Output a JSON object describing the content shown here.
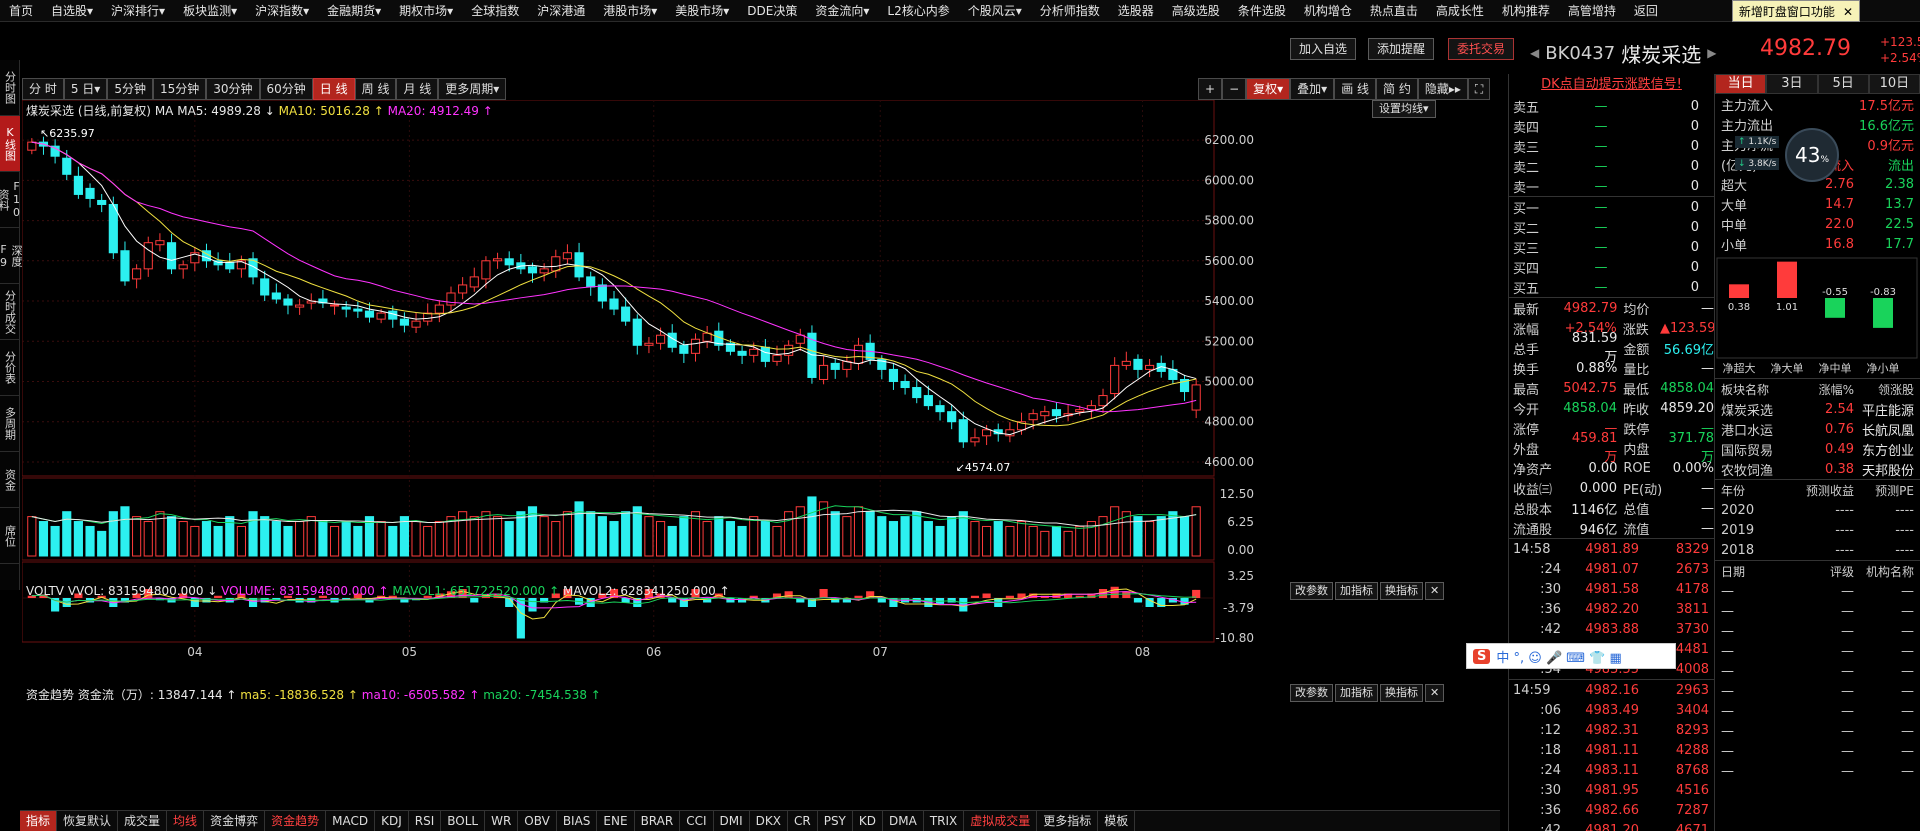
{
  "menu": [
    "首页",
    "自选股▾",
    "沪深排行▾",
    "板块监测▾",
    "沪深指数▾",
    "金融期货▾",
    "期权市场▾",
    "全球指数",
    "沪深港通",
    "港股市场▾",
    "美股市场▾",
    "DDE决策",
    "资金流向▾",
    "L2核心内参",
    "个股风云▾",
    "分析师指数",
    "选股器",
    "高级选股",
    "条件选股",
    "机构增仓",
    "热点直击",
    "高成长性",
    "机构推荐",
    "高管增持",
    "返回"
  ],
  "notice": {
    "text": "新增盯盘窗口功能",
    "close": "✕"
  },
  "left_nav": [
    "分时图",
    "K线图",
    "F10资料",
    "深度F9",
    "分时成交",
    "分价表",
    "多周期",
    "资金",
    "席位"
  ],
  "top_buttons": [
    "加入自选",
    "添加提醒",
    "委托交易"
  ],
  "stock": {
    "code": "BK0437",
    "name": "煤炭采选",
    "price": "4982.79",
    "change": "+123.59",
    "pct": "+2.54%"
  },
  "period_bar": [
    "分 时",
    "5 日▾",
    "5分钟",
    "15分钟",
    "30分钟",
    "60分钟",
    "日 线",
    "周 线",
    "月 线",
    "更多周期▾"
  ],
  "right_tools": [
    "+",
    "−",
    "复权▾",
    "叠加▾",
    "画 线",
    "简 约",
    "隐藏▸▸",
    "⛶"
  ],
  "dk_link": "DK点自动提示涨跌信号!",
  "ma_legend": {
    "title": "煤炭采选 (日线,前复权)",
    "ma": "MA",
    "ma5": "MA5: 4989.28 ↓",
    "ma10": "MA10: 5016.28 ↑",
    "ma20": "MA20: 4912.49 ↑",
    "set": "设置均线▾"
  },
  "vol_legend": {
    "name": "VOLTV",
    "vvol": "VVOL: 831594800.000 ↓",
    "volume": "VOLUME: 831594800.000 ↑",
    "mavol1": "MAVOL1: 651722520.000 ↑",
    "mavol2": "MAVOL2: 628341250.000 ↑"
  },
  "flow_legend": {
    "name": "资金趋势",
    "zjl": "资金流（万）: 13847.144 ↑",
    "ma5": "ma5: -18836.528 ↑",
    "ma10": "ma10: -6505.582 ↑",
    "ma20": "ma20: -7454.538 ↑"
  },
  "panel_btns": [
    "改参数",
    "加指标",
    "换指标",
    "✕"
  ],
  "order_book": [
    {
      "k": "卖五",
      "v": "—",
      "n": "0"
    },
    {
      "k": "卖四",
      "v": "—",
      "n": "0"
    },
    {
      "k": "卖三",
      "v": "—",
      "n": "0"
    },
    {
      "k": "卖二",
      "v": "—",
      "n": "0"
    },
    {
      "k": "卖一",
      "v": "—",
      "n": "0"
    },
    {
      "k": "买一",
      "v": "—",
      "n": "0"
    },
    {
      "k": "买二",
      "v": "—",
      "n": "0"
    },
    {
      "k": "买三",
      "v": "—",
      "n": "0"
    },
    {
      "k": "买四",
      "v": "—",
      "n": "0"
    },
    {
      "k": "买五",
      "v": "—",
      "n": "0"
    }
  ],
  "stats": [
    [
      "最新",
      "4982.79",
      "均价",
      "—"
    ],
    [
      "涨幅",
      "+2.54%",
      "涨跌",
      "▲123.59"
    ],
    [
      "总手",
      "831.59万",
      "金额",
      "56.69亿"
    ],
    [
      "换手",
      "0.88%",
      "量比",
      "—"
    ],
    [
      "最高",
      "5042.75",
      "最低",
      "4858.04"
    ],
    [
      "今开",
      "4858.04",
      "昨收",
      "4859.20"
    ],
    [
      "涨停",
      "—",
      "跌停",
      "—"
    ],
    [
      "外盘",
      "459.81万",
      "内盘",
      "371.78万"
    ],
    [
      "净资产",
      "0.00",
      "ROE",
      "0.00%"
    ],
    [
      "收益㈢",
      "0.000",
      "PE(动)",
      "—"
    ],
    [
      "总股本",
      "1146亿",
      "总值",
      "—"
    ],
    [
      "流通股",
      "946亿",
      "流值",
      "—"
    ]
  ],
  "ticks": [
    [
      "14:58",
      "4981.89",
      "8329"
    ],
    [
      ":24",
      "4981.07",
      "2673"
    ],
    [
      ":30",
      "4981.58",
      "4178"
    ],
    [
      ":36",
      "4982.20",
      "3811"
    ],
    [
      ":42",
      "4983.88",
      "3730"
    ],
    [
      ":48",
      "4983.62",
      "4481"
    ],
    [
      ":54",
      "4983.55",
      "4008"
    ],
    [
      "14:59",
      "4982.16",
      "2963"
    ],
    [
      ":06",
      "4983.49",
      "3404"
    ],
    [
      ":12",
      "4982.31",
      "8293"
    ],
    [
      ":18",
      "4981.11",
      "4288"
    ],
    [
      ":24",
      "4983.11",
      "8768"
    ],
    [
      ":30",
      "4981.95",
      "4516"
    ],
    [
      ":36",
      "4982.66",
      "7287"
    ],
    [
      ":42",
      "4981.20",
      "4671"
    ]
  ],
  "flow_tabs": [
    "当日",
    "3日",
    "5日",
    "10日"
  ],
  "flow_rows": [
    [
      "主力流入",
      "17.5亿元"
    ],
    [
      "主力流出",
      "16.6亿元"
    ],
    [
      "主力净流",
      "0.9亿元"
    ]
  ],
  "flow_hdr": [
    "(亿元)",
    "流入",
    "流出"
  ],
  "flow_table": [
    [
      "超大",
      "2.76",
      "2.38"
    ],
    [
      "大单",
      "14.7",
      "13.7"
    ],
    [
      "中单",
      "22.0",
      "22.5"
    ],
    [
      "小单",
      "16.8",
      "17.7"
    ]
  ],
  "net_bars": {
    "labels": [
      "净超大",
      "净大单",
      "净中单",
      "净小单"
    ],
    "values": [
      0.38,
      1.01,
      -0.55,
      -0.83
    ]
  },
  "speed": {
    "up": "1.1K/s",
    "down": "3.8K/s",
    "pct": "43"
  },
  "lead_hdr": [
    "板块名称",
    "涨幅%",
    "领涨股"
  ],
  "leaders": [
    [
      "煤炭采选",
      "2.54",
      "平庄能源"
    ],
    [
      "港口水运",
      "0.76",
      "长航凤凰"
    ],
    [
      "国际贸易",
      "0.49",
      "东方创业"
    ],
    [
      "农牧饲渔",
      "0.38",
      "天邦股份"
    ]
  ],
  "forecast_hdr": [
    "年份",
    "预测收益",
    "预测PE"
  ],
  "forecast": [
    [
      "2020",
      "----",
      "----"
    ],
    [
      "2019",
      "----",
      "----"
    ],
    [
      "2018",
      "----",
      "----"
    ]
  ],
  "rating_hdr": [
    "日期",
    "评级",
    "机构名称"
  ],
  "bottom_tabs": [
    "指标",
    "恢复默认",
    "成交量",
    "均线",
    "资金博弈",
    "资金趋势",
    "MACD",
    "KDJ",
    "RSI",
    "BOLL",
    "WR",
    "OBV",
    "BIAS",
    "ENE",
    "BRAR",
    "CCI",
    "DMI",
    "DKX",
    "CR",
    "PSY",
    "KD",
    "DMA",
    "TRIX",
    "虚拟成交量",
    "更多指标",
    "模板"
  ],
  "ime": "中 °, ☺ 🎤 ⌨ 👕 ▦",
  "colors": {
    "up": "#ff3b3b",
    "down": "#2cf0f0",
    "ma5": "#ffffff",
    "ma10": "#f0e040",
    "ma20": "#ff33ff"
  },
  "chart_data": {
    "type": "candlestick",
    "ylim": [
      4550,
      6300
    ],
    "yticks": [
      "6200.00",
      "6000.00",
      "5800.00",
      "5600.00",
      "5400.00",
      "5200.00",
      "5000.00",
      "4800.00",
      "4600.00"
    ],
    "xticks": [
      "04",
      "05",
      "06",
      "07",
      "08"
    ],
    "annotations": {
      "high": "6235.97",
      "low": "4574.07"
    },
    "vol_ticks": [
      "12.50",
      "6.25",
      "0.00"
    ],
    "flow_ticks": [
      "3.25",
      "-3.79",
      "-10.80"
    ],
    "close": [
      6190,
      6170,
      6120,
      6030,
      5930,
      5910,
      5880,
      5640,
      5500,
      5560,
      5690,
      5700,
      5560,
      5580,
      5640,
      5600,
      5580,
      5560,
      5600,
      5520,
      5430,
      5410,
      5380,
      5380,
      5400,
      5390,
      5380,
      5360,
      5350,
      5320,
      5340,
      5310,
      5280,
      5300,
      5340,
      5380,
      5440,
      5480,
      5520,
      5600,
      5610,
      5580,
      5560,
      5540,
      5560,
      5620,
      5640,
      5520,
      5470,
      5400,
      5360,
      5300,
      5180,
      5190,
      5230,
      5170,
      5140,
      5210,
      5240,
      5180,
      5150,
      5130,
      5160,
      5100,
      5130,
      5180,
      5230,
      5020,
      5080,
      5060,
      5100,
      5180,
      5110,
      5060,
      5000,
      4970,
      4920,
      4880,
      4850,
      4800,
      4700,
      4720,
      4760,
      4740,
      4760,
      4800,
      4840,
      4850,
      4830,
      4840,
      4860,
      4880,
      4930,
      5080,
      5100,
      5060,
      5080,
      5050,
      5010,
      4950,
      4983
    ],
    "open": [
      6150,
      6190,
      6170,
      6110,
      6020,
      5960,
      5900,
      5880,
      5650,
      5510,
      5560,
      5680,
      5690,
      5560,
      5590,
      5650,
      5600,
      5590,
      5560,
      5610,
      5510,
      5440,
      5410,
      5370,
      5390,
      5410,
      5380,
      5370,
      5360,
      5350,
      5310,
      5350,
      5310,
      5270,
      5300,
      5340,
      5380,
      5440,
      5470,
      5510,
      5600,
      5610,
      5590,
      5570,
      5540,
      5550,
      5610,
      5640,
      5520,
      5480,
      5410,
      5370,
      5310,
      5180,
      5190,
      5240,
      5180,
      5140,
      5200,
      5250,
      5190,
      5150,
      5130,
      5170,
      5100,
      5130,
      5190,
      5240,
      5010,
      5090,
      5060,
      5090,
      5190,
      5110,
      5060,
      5000,
      4970,
      4930,
      4880,
      4850,
      4810,
      4700,
      4730,
      4760,
      4730,
      4760,
      4810,
      4830,
      4860,
      4830,
      4850,
      4860,
      4880,
      4940,
      5080,
      5110,
      5060,
      5090,
      5060,
      5010,
      4858
    ],
    "volume": [
      8,
      7,
      6,
      9,
      7,
      6,
      5,
      9,
      10,
      8,
      7,
      9,
      8,
      7,
      6,
      7,
      6,
      8,
      6,
      9,
      8,
      7,
      6,
      7,
      8,
      7,
      6,
      7,
      6,
      8,
      7,
      6,
      8,
      7,
      6,
      7,
      8,
      9,
      8,
      9,
      8,
      7,
      9,
      10,
      8,
      7,
      9,
      11,
      9,
      8,
      7,
      9,
      10,
      8,
      7,
      6,
      8,
      9,
      7,
      8,
      7,
      6,
      8,
      7,
      6,
      9,
      10,
      12,
      11,
      9,
      8,
      10,
      9,
      8,
      7,
      8,
      9,
      7,
      6,
      8,
      9,
      7,
      6,
      7,
      6,
      7,
      6,
      5,
      6,
      5,
      6,
      7,
      8,
      10,
      9,
      8,
      7,
      8,
      9,
      8,
      10
    ],
    "flow": [
      0.5,
      0.8,
      -3,
      -2,
      1,
      -1,
      0.5,
      -2,
      -1,
      1,
      2,
      -0.5,
      -1,
      1,
      -2,
      -1,
      0.5,
      -1,
      1,
      -2,
      -1,
      -0.5,
      0.5,
      -1,
      -1,
      0.5,
      -1,
      -0.5,
      1,
      -1,
      0.5,
      0.5,
      -1,
      -0.5,
      0.5,
      1,
      1.5,
      2,
      -1,
      0.8,
      1,
      -2,
      -9,
      -3,
      -1,
      1,
      2,
      -1.5,
      -2,
      1,
      2,
      -1,
      -2,
      2,
      1,
      -1,
      -2,
      2,
      -1,
      1,
      -1,
      -1,
      0.5,
      -1,
      1,
      1.5,
      -1,
      -2,
      2,
      -1,
      -1,
      0.5,
      1.5,
      -1,
      -2,
      -1,
      -1,
      -2,
      -1.5,
      -1,
      -3,
      0.5,
      1,
      -2,
      0.5,
      1,
      1,
      0.5,
      1,
      1,
      0.5,
      1,
      2,
      2.5,
      1.5,
      -1,
      -2,
      -2,
      -1,
      -1.5,
      1.8
    ]
  }
}
